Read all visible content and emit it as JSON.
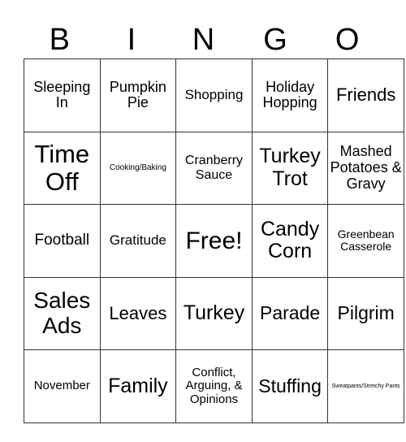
{
  "header": [
    "B",
    "I",
    "N",
    "G",
    "O"
  ],
  "rows": [
    [
      {
        "text": "Sleeping In",
        "size": 18
      },
      {
        "text": "Pumpkin Pie",
        "size": 18
      },
      {
        "text": "Shopping",
        "size": 17
      },
      {
        "text": "Holiday Hopping",
        "size": 18
      },
      {
        "text": "Friends",
        "size": 22
      }
    ],
    [
      {
        "text": "Time Off",
        "size": 31
      },
      {
        "text": "Cooking/Baking",
        "size": 10
      },
      {
        "text": "Cranberry Sauce",
        "size": 16
      },
      {
        "text": "Turkey Trot",
        "size": 25
      },
      {
        "text": "Mashed Potatoes & Gravy",
        "size": 18
      }
    ],
    [
      {
        "text": "Football",
        "size": 19
      },
      {
        "text": "Gratitude",
        "size": 17
      },
      {
        "text": "Free!",
        "size": 30
      },
      {
        "text": "Candy Corn",
        "size": 25
      },
      {
        "text": "Greenbean Casserole",
        "size": 14
      }
    ],
    [
      {
        "text": "Sales Ads",
        "size": 28
      },
      {
        "text": "Leaves",
        "size": 22
      },
      {
        "text": "Turkey",
        "size": 25
      },
      {
        "text": "Parade",
        "size": 23
      },
      {
        "text": "Pilgrim",
        "size": 23
      }
    ],
    [
      {
        "text": "November",
        "size": 15
      },
      {
        "text": "Family",
        "size": 25
      },
      {
        "text": "Conflict, Arguing, & Opinions",
        "size": 15
      },
      {
        "text": "Stuffing",
        "size": 23
      },
      {
        "text": "Sweatpants/Stretchy Pants",
        "size": 7
      }
    ]
  ]
}
